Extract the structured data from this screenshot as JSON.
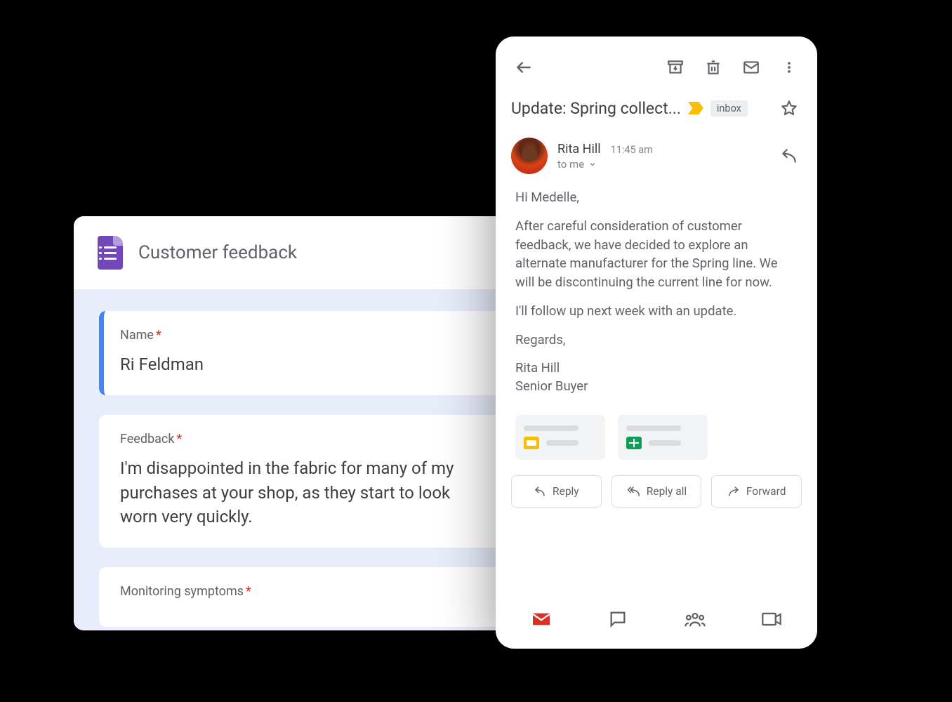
{
  "forms": {
    "title": "Customer feedback",
    "fields": [
      {
        "label": "Name",
        "required": true,
        "value": "Ri Feldman",
        "active": true
      },
      {
        "label": "Feedback",
        "required": true,
        "value": "I'm disappointed in the fabric for many of my purchases at your shop, as they start to look worn very quickly.",
        "active": false
      },
      {
        "label": "Monitoring symptoms",
        "required": true,
        "value": "",
        "active": false
      }
    ]
  },
  "gmail": {
    "subject": "Update: Spring collect...",
    "inbox_chip": "inbox",
    "sender": {
      "name": "Rita Hill",
      "time": "11:45 am",
      "to": "to me"
    },
    "body": {
      "greeting": "Hi Medelle,",
      "p1": "After careful consideration of customer feedback, we have decided to explore an alternate manufacturer for the Spring line. We will be discontinuing the current line for now.",
      "p2": "I'll follow up next week with an update.",
      "closing": "Regards,",
      "sig_name": "Rita Hill",
      "sig_title": "Senior Buyer"
    },
    "actions": {
      "reply": "Reply",
      "reply_all": "Reply all",
      "forward": "Forward"
    }
  }
}
